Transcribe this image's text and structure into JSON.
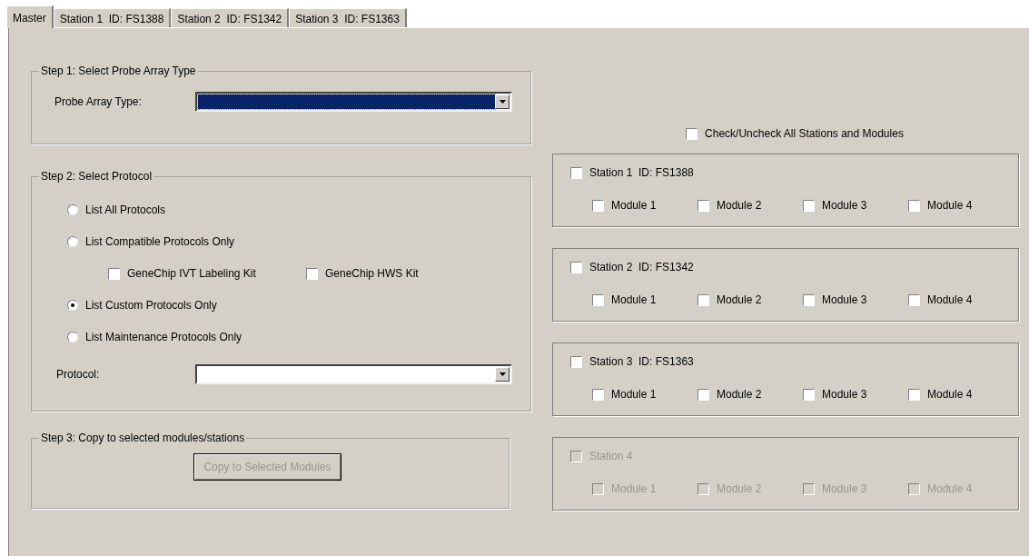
{
  "tabs": [
    {
      "label": "Master",
      "selected": true
    },
    {
      "label": "Station 1  ID: FS1388",
      "selected": false
    },
    {
      "label": "Station 2  ID: FS1342",
      "selected": false
    },
    {
      "label": "Station 3  ID: FS1363",
      "selected": false
    }
  ],
  "step1": {
    "legend": "Step 1: Select Probe Array Type",
    "label": "Probe Array Type:",
    "focused": true
  },
  "step2": {
    "legend": "Step 2: Select Protocol",
    "options": [
      {
        "label": "List All Protocols",
        "selected": false
      },
      {
        "label": "List Compatible Protocols Only",
        "selected": false,
        "kits": [
          {
            "label": "GeneChip IVT Labeling Kit",
            "checked": false
          },
          {
            "label": "GeneChip HWS Kit",
            "checked": false
          }
        ]
      },
      {
        "label": "List Custom Protocols Only",
        "selected": true
      },
      {
        "label": "List Maintenance Protocols Only",
        "selected": false
      }
    ],
    "protocol_label": "Protocol:",
    "protocol_focused": false
  },
  "step3": {
    "legend": "Step 3: Copy to selected modules/stations",
    "button": "Copy to Selected Modules",
    "button_disabled": true
  },
  "check_all": {
    "label": "Check/Uncheck All Stations and Modules",
    "checked": false
  },
  "stations": [
    {
      "label": "Station 1  ID: FS1388",
      "checked": false,
      "disabled": false,
      "modules": [
        {
          "label": "Module 1",
          "checked": false
        },
        {
          "label": "Module 2",
          "checked": false
        },
        {
          "label": "Module 3",
          "checked": false
        },
        {
          "label": "Module 4",
          "checked": false
        }
      ]
    },
    {
      "label": "Station 2  ID: FS1342",
      "checked": false,
      "disabled": false,
      "modules": [
        {
          "label": "Module 1",
          "checked": false
        },
        {
          "label": "Module 2",
          "checked": false
        },
        {
          "label": "Module 3",
          "checked": false
        },
        {
          "label": "Module 4",
          "checked": false
        }
      ]
    },
    {
      "label": "Station 3  ID: FS1363",
      "checked": false,
      "disabled": false,
      "modules": [
        {
          "label": "Module 1",
          "checked": false
        },
        {
          "label": "Module 2",
          "checked": false
        },
        {
          "label": "Module 3",
          "checked": false
        },
        {
          "label": "Module 4",
          "checked": false
        }
      ]
    },
    {
      "label": "Station 4",
      "checked": false,
      "disabled": true,
      "modules": [
        {
          "label": "Module 1",
          "checked": false
        },
        {
          "label": "Module 2",
          "checked": false
        },
        {
          "label": "Module 3",
          "checked": false
        },
        {
          "label": "Module 4",
          "checked": false
        }
      ]
    }
  ]
}
